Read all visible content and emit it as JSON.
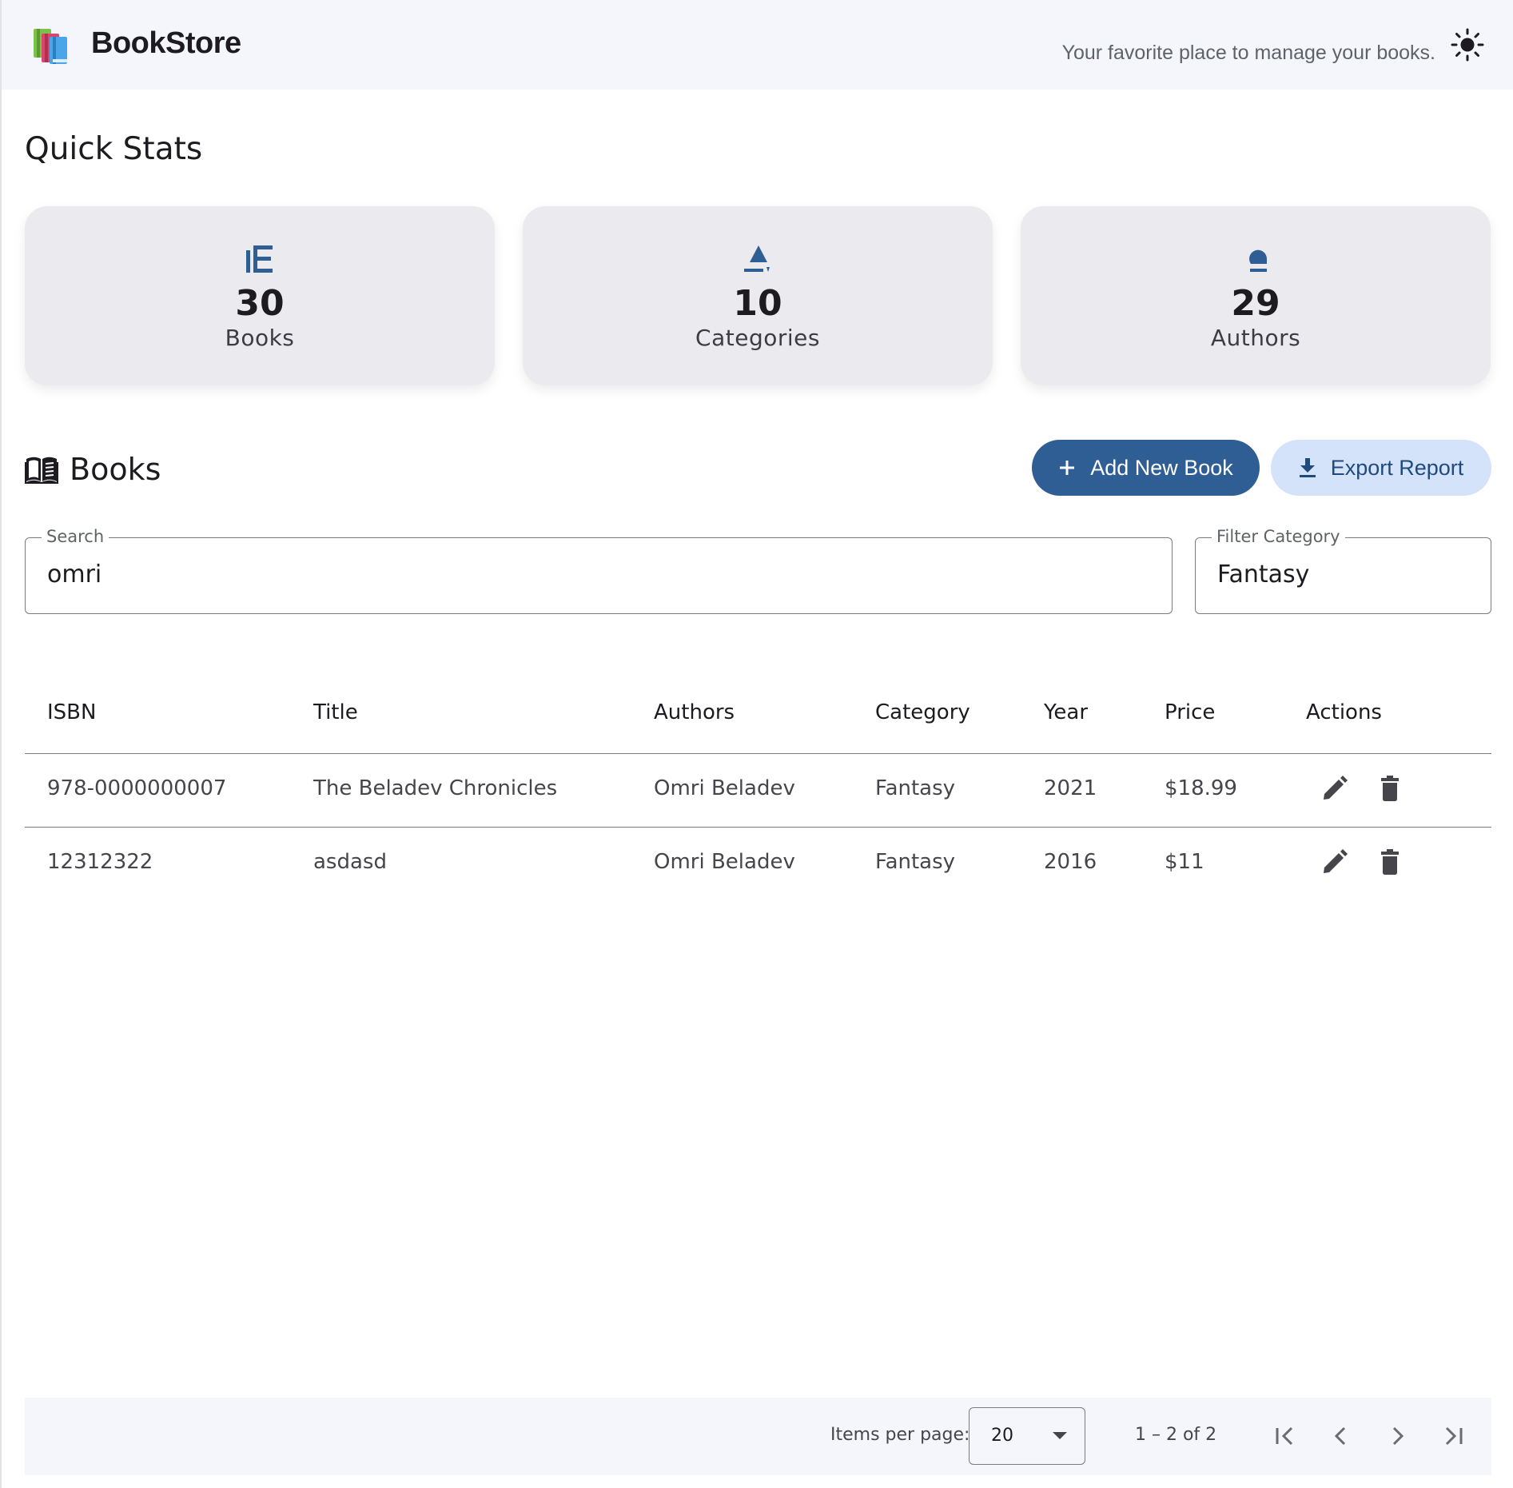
{
  "header": {
    "brand": "BookStore",
    "tagline": "Your favorite place to manage your books.",
    "theme_icon": "sun-icon"
  },
  "quick_stats": {
    "title": "Quick Stats",
    "cards": [
      {
        "icon": "library-books-icon",
        "value": "30",
        "label": "Books"
      },
      {
        "icon": "category-icon",
        "value": "10",
        "label": "Categories"
      },
      {
        "icon": "person-icon",
        "value": "29",
        "label": "Authors"
      }
    ]
  },
  "books": {
    "title": "Books",
    "icon": "menu-book-icon",
    "add_label": "Add New Book",
    "export_label": "Export Report"
  },
  "filters": {
    "search_label": "Search",
    "search_value": "omri",
    "category_label": "Filter Category",
    "category_value": "Fantasy"
  },
  "table": {
    "columns": [
      "ISBN",
      "Title",
      "Authors",
      "Category",
      "Year",
      "Price",
      "Actions"
    ],
    "rows": [
      {
        "isbn": "978-0000000007",
        "title": "The Beladev Chronicles",
        "authors": "Omri Beladev",
        "category": "Fantasy",
        "year": "2021",
        "price": "$18.99"
      },
      {
        "isbn": "12312322",
        "title": "asdasd",
        "authors": "Omri Beladev",
        "category": "Fantasy",
        "year": "2016",
        "price": "$11"
      }
    ]
  },
  "paginator": {
    "items_per_page_label": "Items per page:",
    "page_size": "20",
    "range_label": "1 – 2 of 2"
  },
  "colors": {
    "primary": "#2f5e95",
    "secondary_container": "#d4e3fa",
    "card_background": "#ebebef",
    "header_background": "#f4f6fb"
  }
}
